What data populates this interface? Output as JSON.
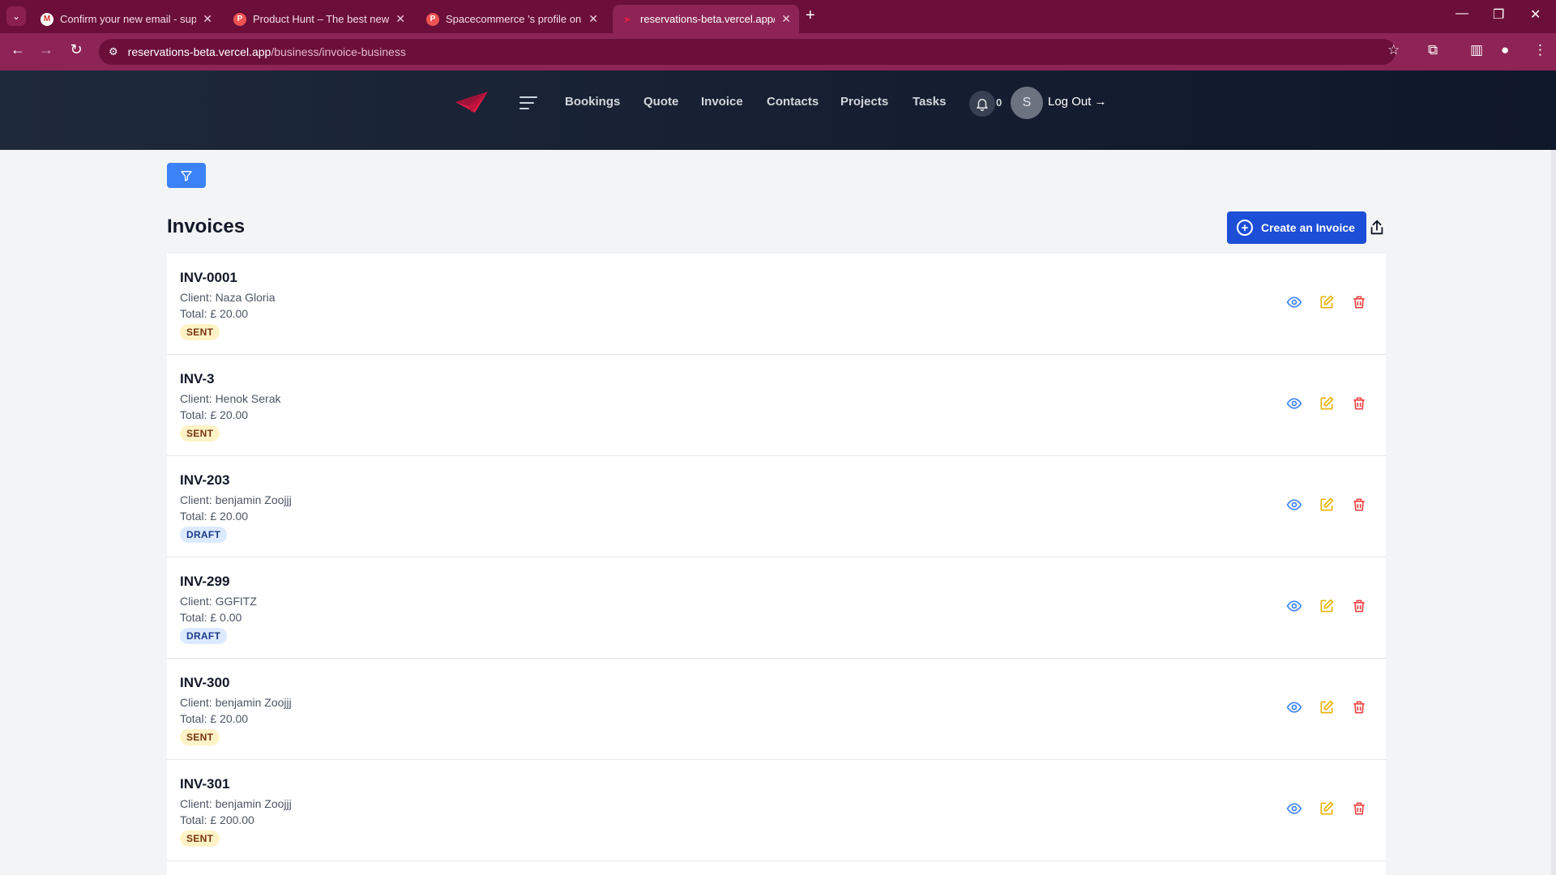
{
  "browser": {
    "tabs": [
      {
        "title": "Confirm your new email - support",
        "favicon": "gmail-icon",
        "active": false
      },
      {
        "title": "Product Hunt – The best new products",
        "favicon": "producthunt-icon",
        "active": false
      },
      {
        "title": "Spacecommerce 's profile on Product Hunt",
        "favicon": "producthunt-icon",
        "active": false
      },
      {
        "title": "reservations-beta.vercel.app/business",
        "favicon": "paper-plane-icon",
        "active": true
      }
    ],
    "url_host": "reservations-beta.vercel.app",
    "url_path": "/business/invoice-business"
  },
  "header": {
    "nav": [
      "Bookings",
      "Quote",
      "Invoice",
      "Contacts",
      "Projects",
      "Tasks"
    ],
    "notification_count": "0",
    "avatar_initial": "S",
    "logout_label": "Log Out →"
  },
  "main": {
    "title": "Invoices",
    "create_label": "Create an Invoice",
    "invoices": [
      {
        "number": "INV-0001",
        "client": "Client: Naza Gloria",
        "total": "Total: £ 20.00",
        "status": "SENT"
      },
      {
        "number": "INV-3",
        "client": "Client: Henok Serak",
        "total": "Total: £ 20.00",
        "status": "SENT"
      },
      {
        "number": "INV-203",
        "client": "Client: benjamin Zoojjj",
        "total": "Total: £ 20.00",
        "status": "DRAFT"
      },
      {
        "number": "INV-299",
        "client": "Client: GGFITZ",
        "total": "Total: £ 0.00",
        "status": "DRAFT"
      },
      {
        "number": "INV-300",
        "client": "Client: benjamin Zoojjj",
        "total": "Total: £ 20.00",
        "status": "SENT"
      },
      {
        "number": "INV-301",
        "client": "Client: benjamin Zoojjj",
        "total": "Total: £ 200.00",
        "status": "SENT"
      }
    ]
  },
  "colors": {
    "chrome": "#6b0f3a",
    "header": "#0f172a",
    "primary": "#1d4ed8",
    "view_icon": "#3b82f6",
    "edit_icon": "#eab308",
    "delete_icon": "#ef4444"
  }
}
